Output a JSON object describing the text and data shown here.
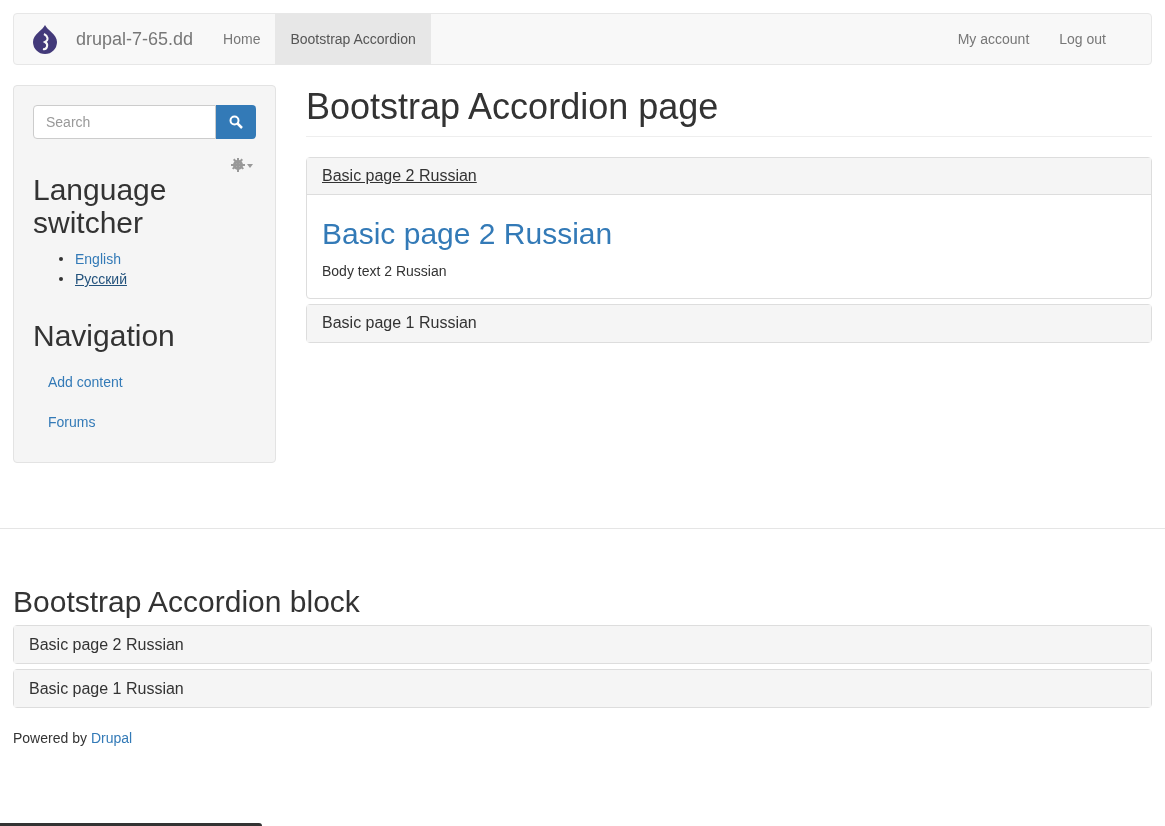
{
  "navbar": {
    "brand": "drupal-7-65.dd",
    "items": [
      {
        "label": "Home",
        "selected": false
      },
      {
        "label": "Bootstrap Accordion",
        "selected": true
      }
    ],
    "right_items": [
      "My account",
      "Log out"
    ]
  },
  "sidebar": {
    "search": {
      "placeholder": "Search"
    },
    "language_title": "Language switcher",
    "languages": [
      {
        "label": "English",
        "selected": false
      },
      {
        "label": "Русский",
        "selected": true
      }
    ],
    "navigation_title": "Navigation",
    "navigation_links": [
      "Add content",
      "Forums"
    ]
  },
  "main": {
    "title": "Bootstrap Accordion page",
    "panels": [
      {
        "title": "Basic page 2 Russian",
        "expanded": true,
        "body_title": "Basic page 2 Russian",
        "body_text": "Body text 2 Russian"
      },
      {
        "title": "Basic page 1 Russian",
        "expanded": false
      }
    ]
  },
  "block": {
    "title": "Bootstrap Accordion block",
    "panels": [
      {
        "title": "Basic page 2 Russian",
        "expanded": false
      },
      {
        "title": "Basic page 1 Russian",
        "expanded": false
      }
    ]
  },
  "footer": {
    "text": "Powered by",
    "link": "Drupal"
  }
}
